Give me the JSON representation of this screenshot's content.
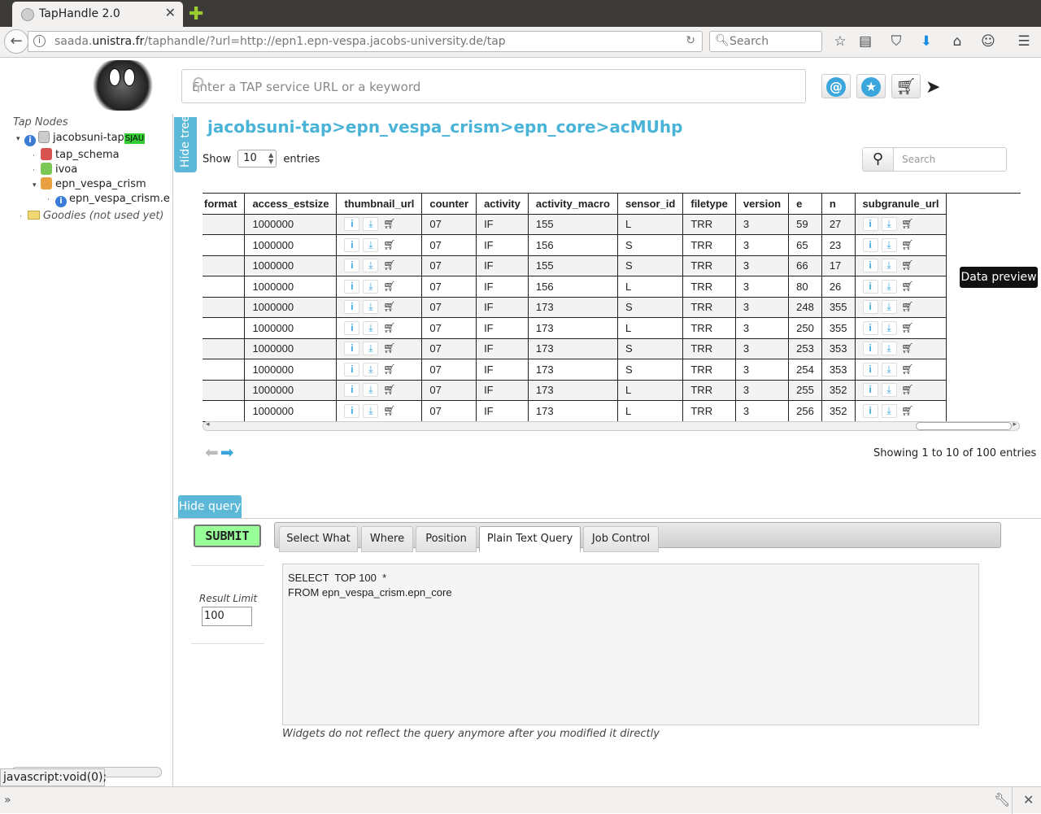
{
  "browser": {
    "tab_title": "TapHandle 2.0",
    "url_prefix": "saada.",
    "url_host": "unistra.fr",
    "url_rest": "/taphandle/?url=http://epn1.epn-vespa.jacobs-university.de/tap",
    "search_placeholder": "Search",
    "status_text": "javascript:void(0);"
  },
  "header": {
    "search_placeholder": "Enter a TAP service URL or a keyword",
    "at_label": "@",
    "star_label": "★"
  },
  "tree": {
    "root_label": "Tap Nodes",
    "service": "jacobsuni-tap",
    "service_badge": "SJAU",
    "items": [
      "tap_schema",
      "ivoa",
      "epn_vespa_crism",
      "epn_vespa_crism.e"
    ],
    "goodies": "Goodies (not used yet)"
  },
  "main": {
    "hide_tree": "Hide tree",
    "breadcrumb": "jacobsuni-tap>epn_vespa_crism>epn_core>acMUhp",
    "show_label": "Show",
    "page_size": "10",
    "entries_label": "entries",
    "search_placeholder": "Search",
    "tooltip": "Data preview",
    "showing_text": "Showing 1 to 10 of 100 entries"
  },
  "table": {
    "columns": [
      "format",
      "access_estsize",
      "thumbnail_url",
      "counter",
      "activity",
      "activity_macro",
      "sensor_id",
      "filetype",
      "version",
      "e",
      "n",
      "subgranule_url"
    ],
    "rows": [
      [
        "",
        "1000000",
        "",
        "07",
        "IF",
        "155",
        "L",
        "TRR",
        "3",
        "59",
        "27",
        ""
      ],
      [
        "",
        "1000000",
        "",
        "07",
        "IF",
        "156",
        "S",
        "TRR",
        "3",
        "65",
        "23",
        ""
      ],
      [
        "",
        "1000000",
        "",
        "07",
        "IF",
        "155",
        "S",
        "TRR",
        "3",
        "66",
        "17",
        ""
      ],
      [
        "",
        "1000000",
        "",
        "07",
        "IF",
        "156",
        "L",
        "TRR",
        "3",
        "80",
        "26",
        ""
      ],
      [
        "",
        "1000000",
        "",
        "07",
        "IF",
        "173",
        "S",
        "TRR",
        "3",
        "248",
        "355",
        ""
      ],
      [
        "",
        "1000000",
        "",
        "07",
        "IF",
        "173",
        "L",
        "TRR",
        "3",
        "250",
        "355",
        ""
      ],
      [
        "",
        "1000000",
        "",
        "07",
        "IF",
        "173",
        "S",
        "TRR",
        "3",
        "253",
        "353",
        ""
      ],
      [
        "",
        "1000000",
        "",
        "07",
        "IF",
        "173",
        "S",
        "TRR",
        "3",
        "254",
        "353",
        ""
      ],
      [
        "",
        "1000000",
        "",
        "07",
        "IF",
        "173",
        "L",
        "TRR",
        "3",
        "255",
        "352",
        ""
      ],
      [
        "",
        "1000000",
        "",
        "07",
        "IF",
        "173",
        "L",
        "TRR",
        "3",
        "256",
        "352",
        ""
      ]
    ]
  },
  "query": {
    "hide_query": "Hide query",
    "submit": "SUBMIT",
    "tabs": [
      "Select What",
      "Where",
      "Position",
      "Plain Text Query",
      "Job Control"
    ],
    "active_tab": "Plain Text Query",
    "result_limit_label": "Result Limit",
    "result_limit": "100",
    "sql": "SELECT  TOP 100  *\nFROM epn_vespa_crism.epn_core",
    "note": "Widgets do not reflect the query anymore after you modified it directly"
  }
}
